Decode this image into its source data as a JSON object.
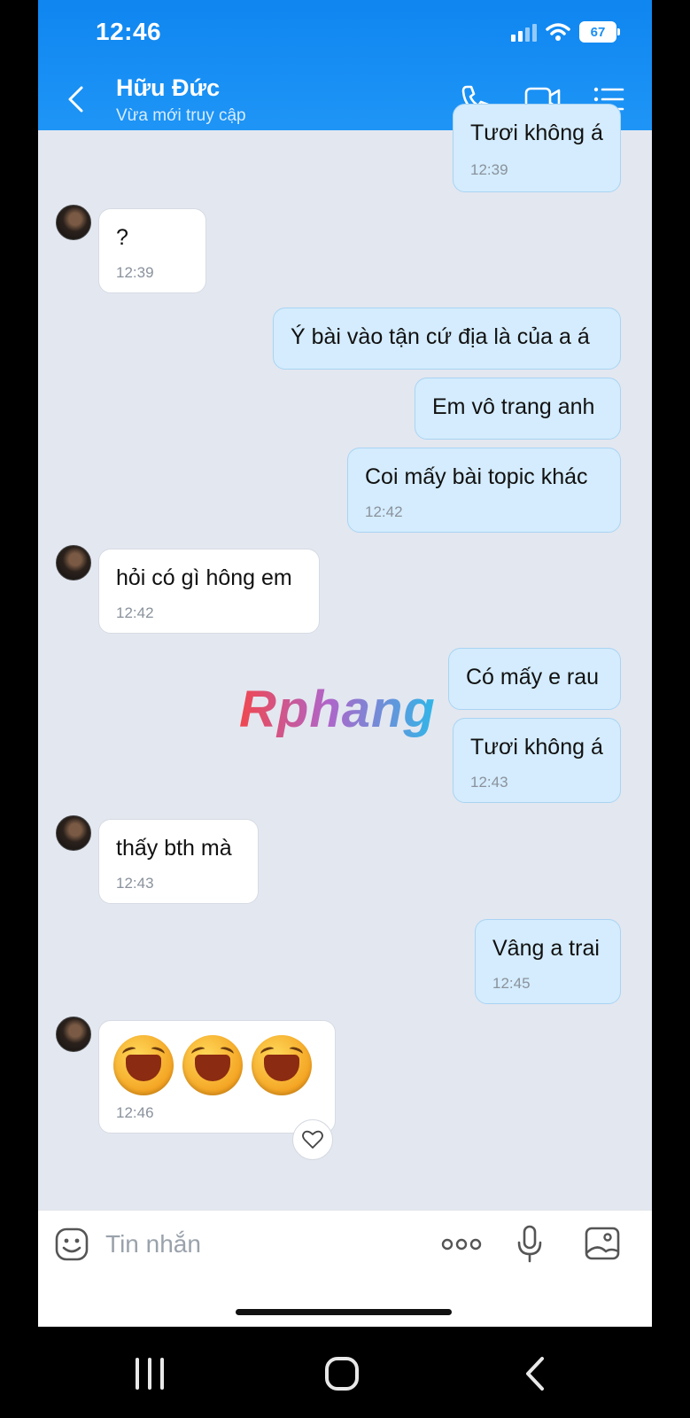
{
  "status_bar": {
    "time": "12:46",
    "battery": "67"
  },
  "header": {
    "contact_name": "Hữu Đức",
    "contact_status": "Vừa mới truy cập"
  },
  "messages": [
    {
      "dir": "out",
      "text": "Tươi không á",
      "time": "12:39"
    },
    {
      "dir": "in",
      "text": "?",
      "time": "12:39"
    },
    {
      "dir": "out",
      "text": "Ý bài vào tận cứ địa là của a á",
      "time": ""
    },
    {
      "dir": "out",
      "text": "Em vô trang anh",
      "time": ""
    },
    {
      "dir": "out",
      "text": "Coi mấy bài topic khác",
      "time": "12:42"
    },
    {
      "dir": "in",
      "text": "hỏi có gì hông em",
      "time": "12:42"
    },
    {
      "dir": "out",
      "text": "Có mấy e rau",
      "time": ""
    },
    {
      "dir": "out",
      "text": "Tươi không á",
      "time": "12:43"
    },
    {
      "dir": "in",
      "text": "thấy bth mà",
      "time": "12:43"
    },
    {
      "dir": "out",
      "text": "Vâng a trai",
      "time": "12:45"
    },
    {
      "dir": "in",
      "text": "",
      "time": "12:46",
      "emoji": [
        "laughing-face",
        "laughing-face",
        "laughing-face"
      ]
    }
  ],
  "watermark": "Rphang",
  "composer": {
    "placeholder": "Tin nhắn"
  },
  "icons": [
    "back-chevron-icon",
    "phone-icon",
    "video-icon",
    "menu-list-icon",
    "emoji-icon",
    "more-icon",
    "microphone-icon",
    "image-icon",
    "heart-icon",
    "nav-recent-icon",
    "nav-home-icon",
    "nav-back-icon"
  ],
  "colors": {
    "header_blue": "#1a8ef3",
    "outgoing_bubble": "#d4ecfd",
    "incoming_bubble": "#ffffff",
    "chat_bg": "#e3e7f0"
  }
}
